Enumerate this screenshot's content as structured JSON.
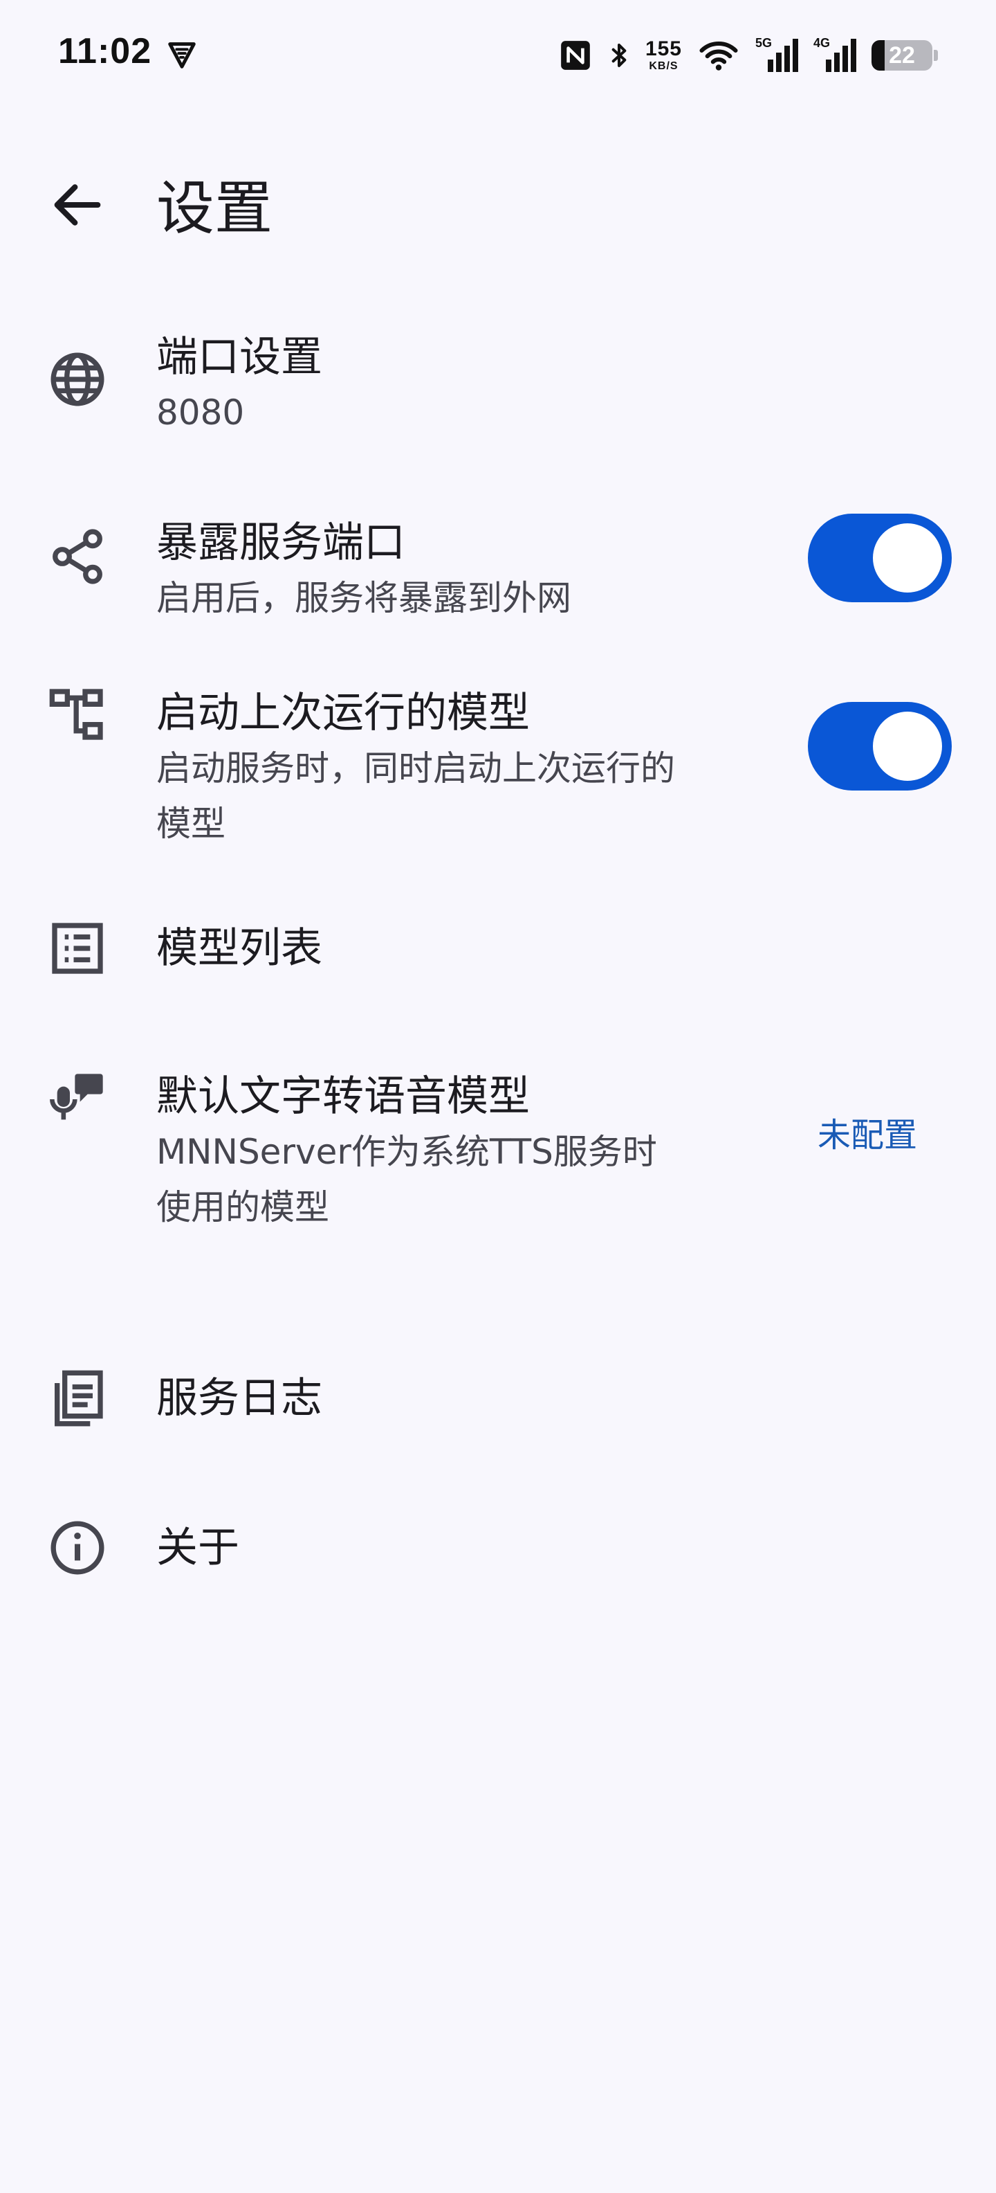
{
  "status_bar": {
    "time": "11:02",
    "net_speed": "155",
    "net_speed_unit": "KB/S",
    "signal_1_label": "5G",
    "signal_2_label": "4G",
    "battery_level": "22",
    "battery_fraction": 0.22
  },
  "app_bar": {
    "title": "设置"
  },
  "settings": {
    "port": {
      "title": "端口设置",
      "value": "8080",
      "icon": "globe-icon"
    },
    "expose": {
      "title": "暴露服务端口",
      "subtitle": "启用后，服务将暴露到外网",
      "icon": "share-icon",
      "enabled": true
    },
    "autostart": {
      "title": "启动上次运行的模型",
      "subtitle_line1": "启动服务时，同时启动上次运行的",
      "subtitle_line2": "模型",
      "icon": "tree-icon",
      "enabled": true
    },
    "model_list": {
      "title": "模型列表",
      "icon": "list-icon"
    },
    "tts": {
      "title": "默认文字转语音模型",
      "subtitle_line1": "MNNServer作为系统TTS服务时",
      "subtitle_line2": "使用的模型",
      "value": "未配置",
      "icon": "voice-chat-icon"
    },
    "logs": {
      "title": "服务日志",
      "icon": "log-icon"
    },
    "about": {
      "title": "关于",
      "icon": "info-icon"
    }
  },
  "colors": {
    "background": "#f8f7fd",
    "accent": "#0a57d6",
    "link": "#1a5bb5",
    "icon": "#46464f"
  }
}
